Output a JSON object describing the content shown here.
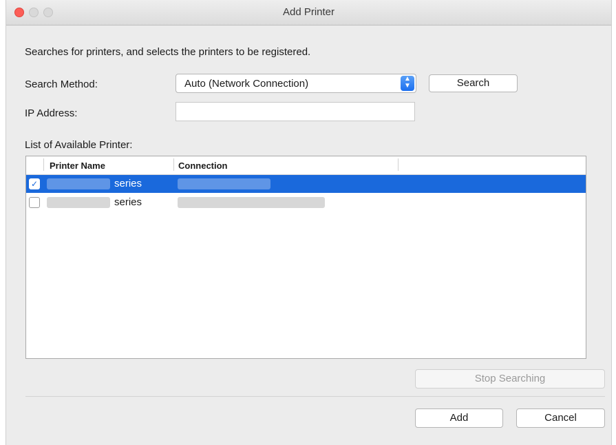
{
  "window": {
    "title": "Add Printer"
  },
  "instructions": "Searches for printers, and selects the printers to be registered.",
  "search_method": {
    "label": "Search Method:",
    "value": "Auto (Network Connection)",
    "search_button": "Search"
  },
  "ip_address": {
    "label": "IP Address:",
    "value": ""
  },
  "printer_list": {
    "label": "List of Available Printer:",
    "columns": [
      "Printer Name",
      "Connection"
    ],
    "rows": [
      {
        "name_suffix": "series",
        "checked": true,
        "selected": true,
        "check_mark": "✓"
      },
      {
        "name_suffix": "series",
        "checked": false,
        "selected": false,
        "check_mark": ""
      }
    ]
  },
  "buttons": {
    "stop_searching": "Stop Searching",
    "add": "Add",
    "cancel": "Cancel"
  },
  "colors": {
    "selection": "#1a69dc",
    "close_button": "#fc5e57"
  }
}
